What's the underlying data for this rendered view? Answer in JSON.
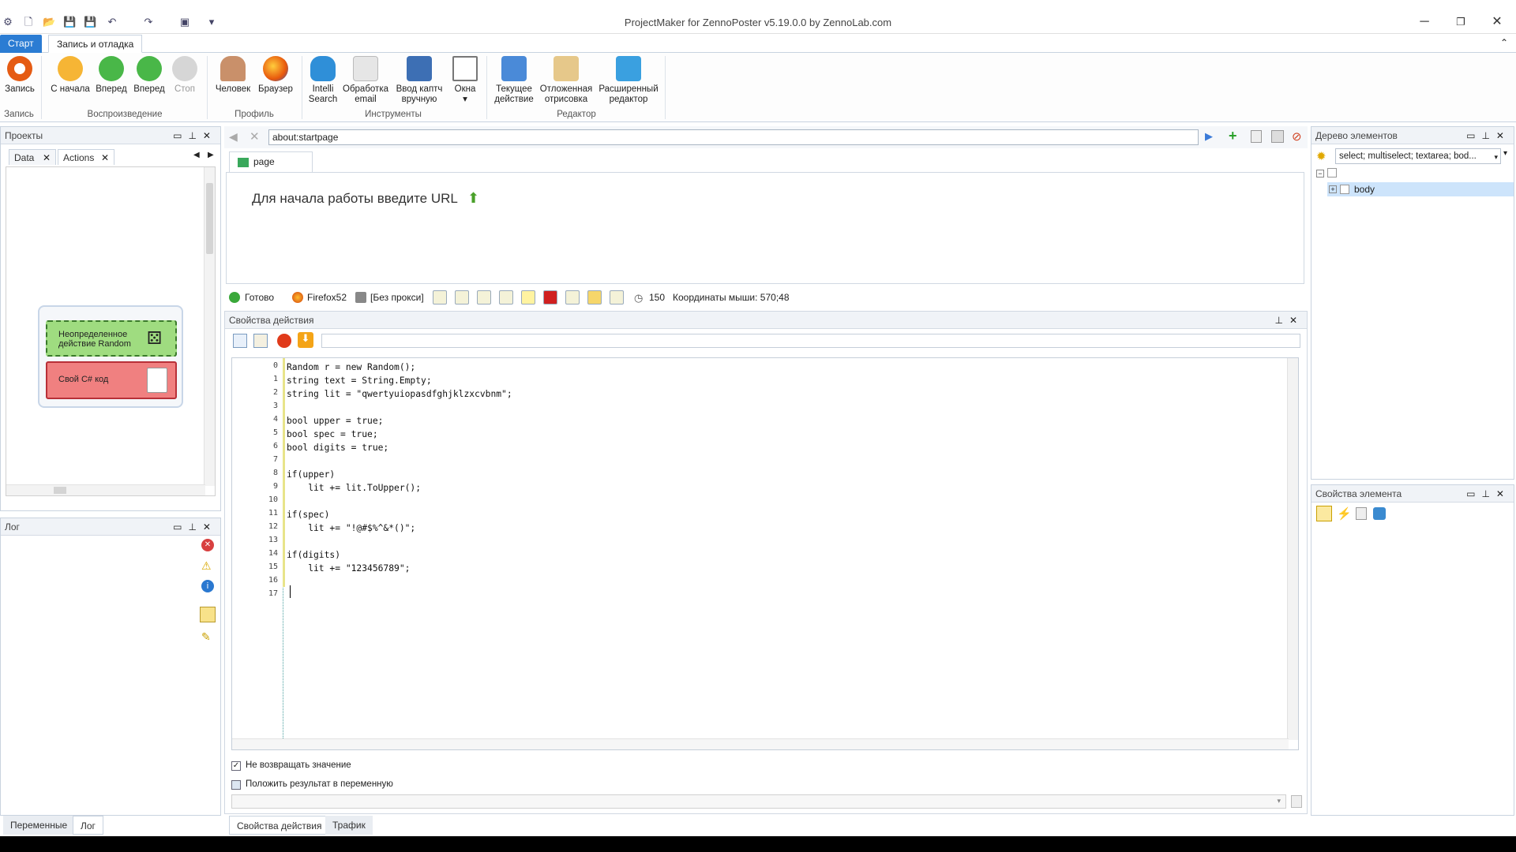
{
  "window": {
    "title": "ProjectMaker for ZennoPoster v5.19.0.0 by ZennoLab.com",
    "minimize": "─",
    "restore": "❐",
    "close": "✕"
  },
  "ribbon_tabs": {
    "start": "Старт",
    "record": "Запись и отладка"
  },
  "ribbon": {
    "buttons": {
      "record": "Запись",
      "from_start": "С начала",
      "forward1": "Вперед",
      "forward2": "Вперед",
      "stop": "Стоп",
      "human": "Человек",
      "browser": "Браузер",
      "intelli1": "Intelli",
      "intelli2": "Search",
      "email1": "Обработка",
      "email2": "email",
      "captcha1": "Ввод каптч",
      "captcha2": "вручную",
      "windows": "Окна",
      "current1": "Текущее",
      "current2": "действие",
      "deferred1": "Отложенная",
      "deferred2": "отрисовка",
      "adv1": "Расширенный",
      "adv2": "редактор"
    },
    "groups": {
      "record": "Запись",
      "playback": "Воспроизведение",
      "profile": "Профиль",
      "tools": "Инструменты",
      "editor": "Редактор"
    }
  },
  "projects_panel": {
    "title": "Проекты",
    "tabs": {
      "data": "Data",
      "actions": "Actions"
    },
    "nodes": {
      "random": "Неопределенное действие Random",
      "csharp": "Свой C# код"
    }
  },
  "log_panel": {
    "title": "Лог"
  },
  "left_bottom_tabs": {
    "variables": "Переменные",
    "log": "Лог"
  },
  "browser": {
    "url": "about:startpage",
    "tab": "page",
    "start_text": "Для начала работы введите URL"
  },
  "status": {
    "ready": "Готово",
    "browser": "Firefox52",
    "proxy": "[Без прокси]",
    "count": "150",
    "mouse": "Координаты мыши: 570;48"
  },
  "action_props": {
    "title": "Свойства действия",
    "lines": [
      "Random r = new Random();",
      "string text = String.Empty;",
      "string lit = \"qwertyuiopasdfghjklzxcvbnm\";",
      "",
      "bool upper = true;",
      "bool spec = true;",
      "bool digits = true;",
      "",
      "if(upper)",
      "    lit += lit.ToUpper();",
      "",
      "if(spec)",
      "    lit += \"!@#$%^&*()\";",
      "",
      "if(digits)",
      "    lit += \"123456789\";",
      "",
      ""
    ],
    "line_numbers": [
      "0",
      "1",
      "2",
      "3",
      "4",
      "5",
      "6",
      "7",
      "8",
      "9",
      "10",
      "11",
      "12",
      "13",
      "14",
      "15",
      "16",
      "17"
    ],
    "no_return": "Не возвращать значение",
    "put_result": "Положить результат в переменную"
  },
  "center_bottom_tabs": {
    "props": "Свойства действия",
    "traffic": "Трафик"
  },
  "element_tree": {
    "title": "Дерево элементов",
    "filter": "select; multiselect; textarea; bod...",
    "node": "body"
  },
  "element_props": {
    "title": "Свойства элемента"
  }
}
